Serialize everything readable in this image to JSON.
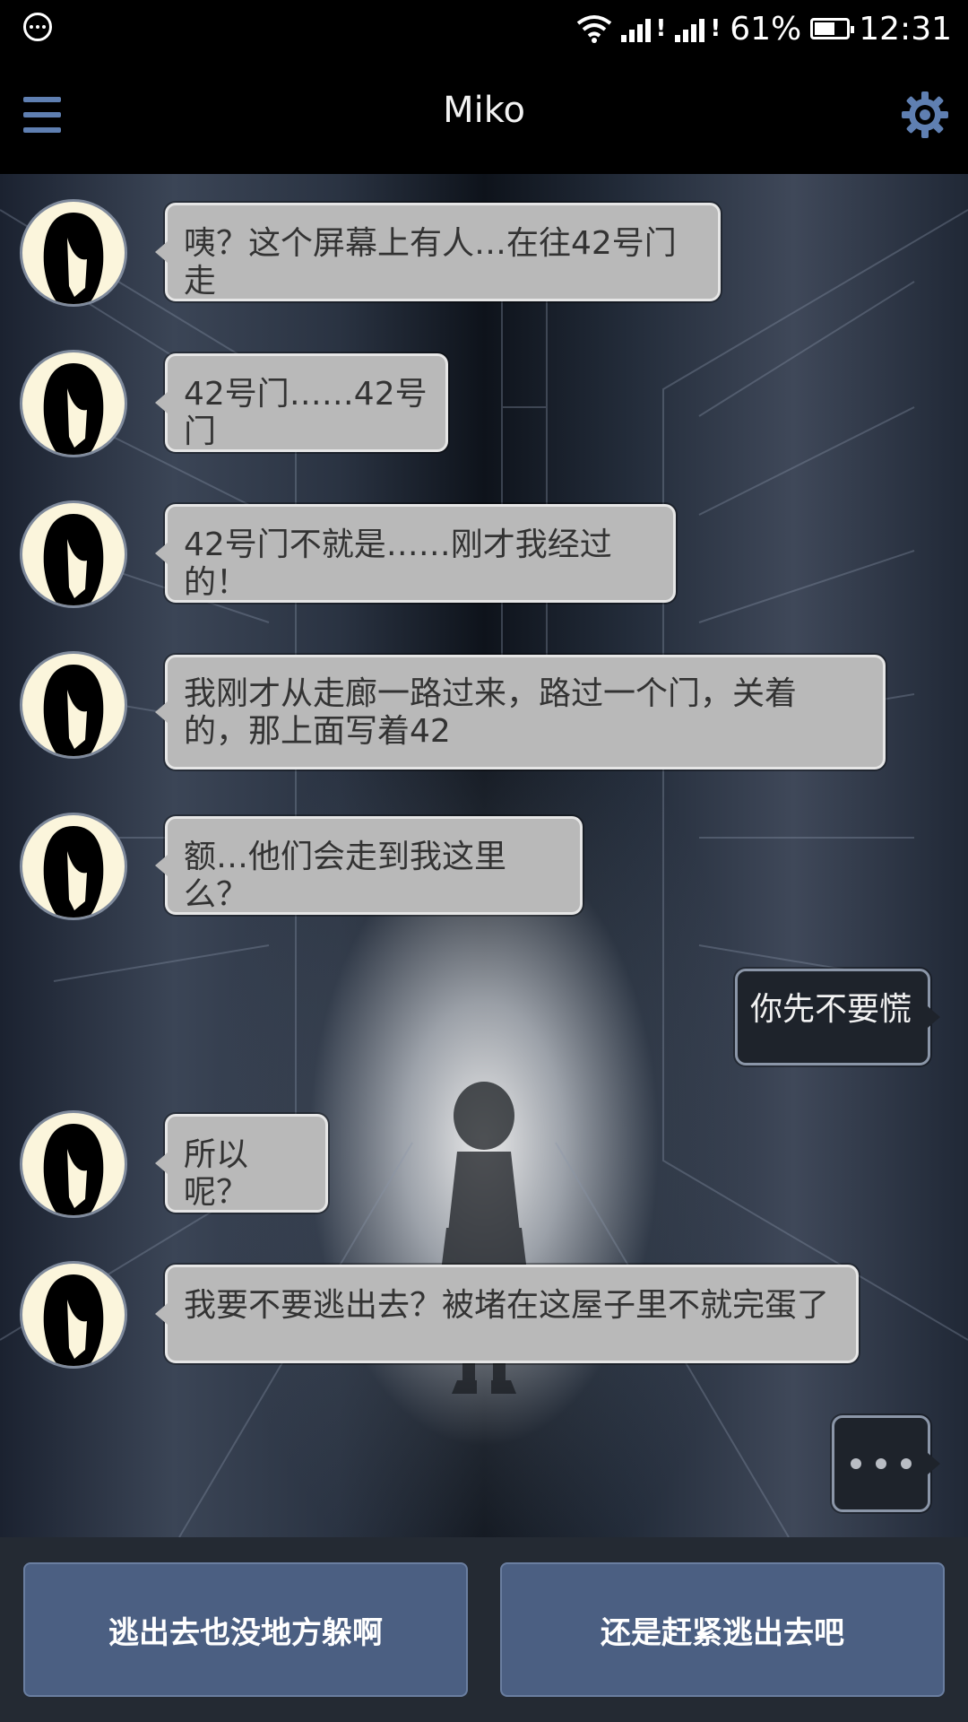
{
  "status_bar": {
    "battery_percent": "61%",
    "time": "12:31",
    "battery_level": 0.61
  },
  "app_bar": {
    "title": "Miko",
    "menu_icon": "hamburger-menu-icon",
    "settings_icon": "gear-icon"
  },
  "messages": [
    {
      "sender": "Miko",
      "text": "咦？这个屏幕上有人…在往42号门走"
    },
    {
      "sender": "Miko",
      "text": "42号门……42号门"
    },
    {
      "sender": "Miko",
      "text": "42号门不就是……刚才我经过的！"
    },
    {
      "sender": "Miko",
      "text_line1": "我刚才从走廊一路过来，路过一个门，关着",
      "text_line2": "的，那上面写着42"
    },
    {
      "sender": "Miko",
      "text": "额…他们会走到我这里么？"
    },
    {
      "sender": "me",
      "text": "你先不要慌"
    },
    {
      "sender": "Miko",
      "text": "所以呢？"
    },
    {
      "sender": "Miko",
      "text": "我要不要逃出去？被堵在这屋子里不就完蛋了"
    }
  ],
  "choices": {
    "option_1": "逃出去也没地方躲啊",
    "option_2": "还是赶紧逃出去吧"
  },
  "colors": {
    "accent": "#5f7fb1",
    "choice_button": "#4b5f82",
    "incoming_bubble": "#b9b9b9",
    "outgoing_bubble": "#1e232b"
  }
}
